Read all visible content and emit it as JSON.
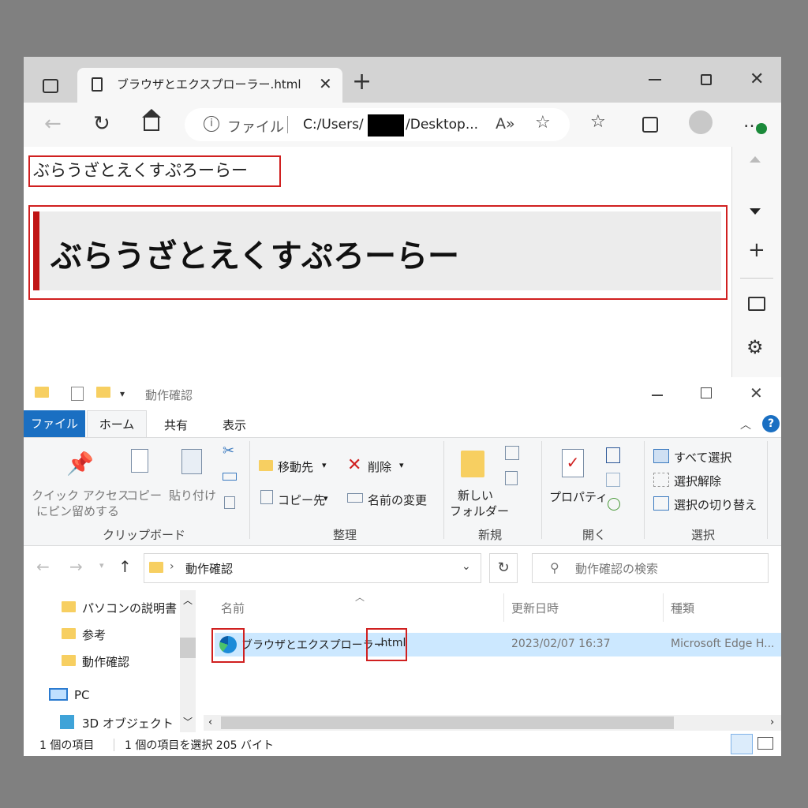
{
  "browser": {
    "tab_title": "ブラウザとエクスプローラー.html",
    "new_tab": "+",
    "address_prefix": "ファイル",
    "url_start": "C:/Users/",
    "url_end": "/Desktop...",
    "page": {
      "small_heading": "ぶらうざとえくすぷろーらー",
      "large_heading": "ぶらうざとえくすぷろーらー"
    }
  },
  "explorer": {
    "title": "動作確認",
    "tabs": [
      "ファイル",
      "ホーム",
      "共有",
      "表示"
    ],
    "ribbon": {
      "clipboard": {
        "pin_line1": "クイック アクセス",
        "pin_line2": "にピン留めする",
        "copy": "コピー",
        "paste": "貼り付け",
        "label": "クリップボード"
      },
      "organize": {
        "move_to": "移動先",
        "copy_to": "コピー先",
        "delete": "削除",
        "rename": "名前の変更",
        "label": "整理"
      },
      "new": {
        "new_folder_line1": "新しい",
        "new_folder_line2": "フォルダー",
        "label": "新規"
      },
      "open": {
        "properties": "プロパティ",
        "label": "開く"
      },
      "select": {
        "select_all": "すべて選択",
        "select_none": "選択解除",
        "invert": "選択の切り替え",
        "label": "選択"
      }
    },
    "address": "動作確認",
    "search_placeholder": "動作確認の検索",
    "tree": [
      "パソコンの説明書",
      "参考",
      "動作確認",
      "PC",
      "3D オブジェクト"
    ],
    "columns": [
      "名前",
      "更新日時",
      "種類"
    ],
    "file": {
      "name_base": "ブラウザとエクスプローラー",
      "name_ext": ".html",
      "modified": "2023/02/07 16:37",
      "type": "Microsoft Edge H..."
    },
    "status": {
      "count": "1 個の項目",
      "selected": "1 個の項目を選択  205 バイト"
    }
  },
  "colors": {
    "highlight_red": "#d02020",
    "heading_bar": "#c01515",
    "file_tab": "#1a6fc2",
    "folder": "#f7cf61"
  }
}
